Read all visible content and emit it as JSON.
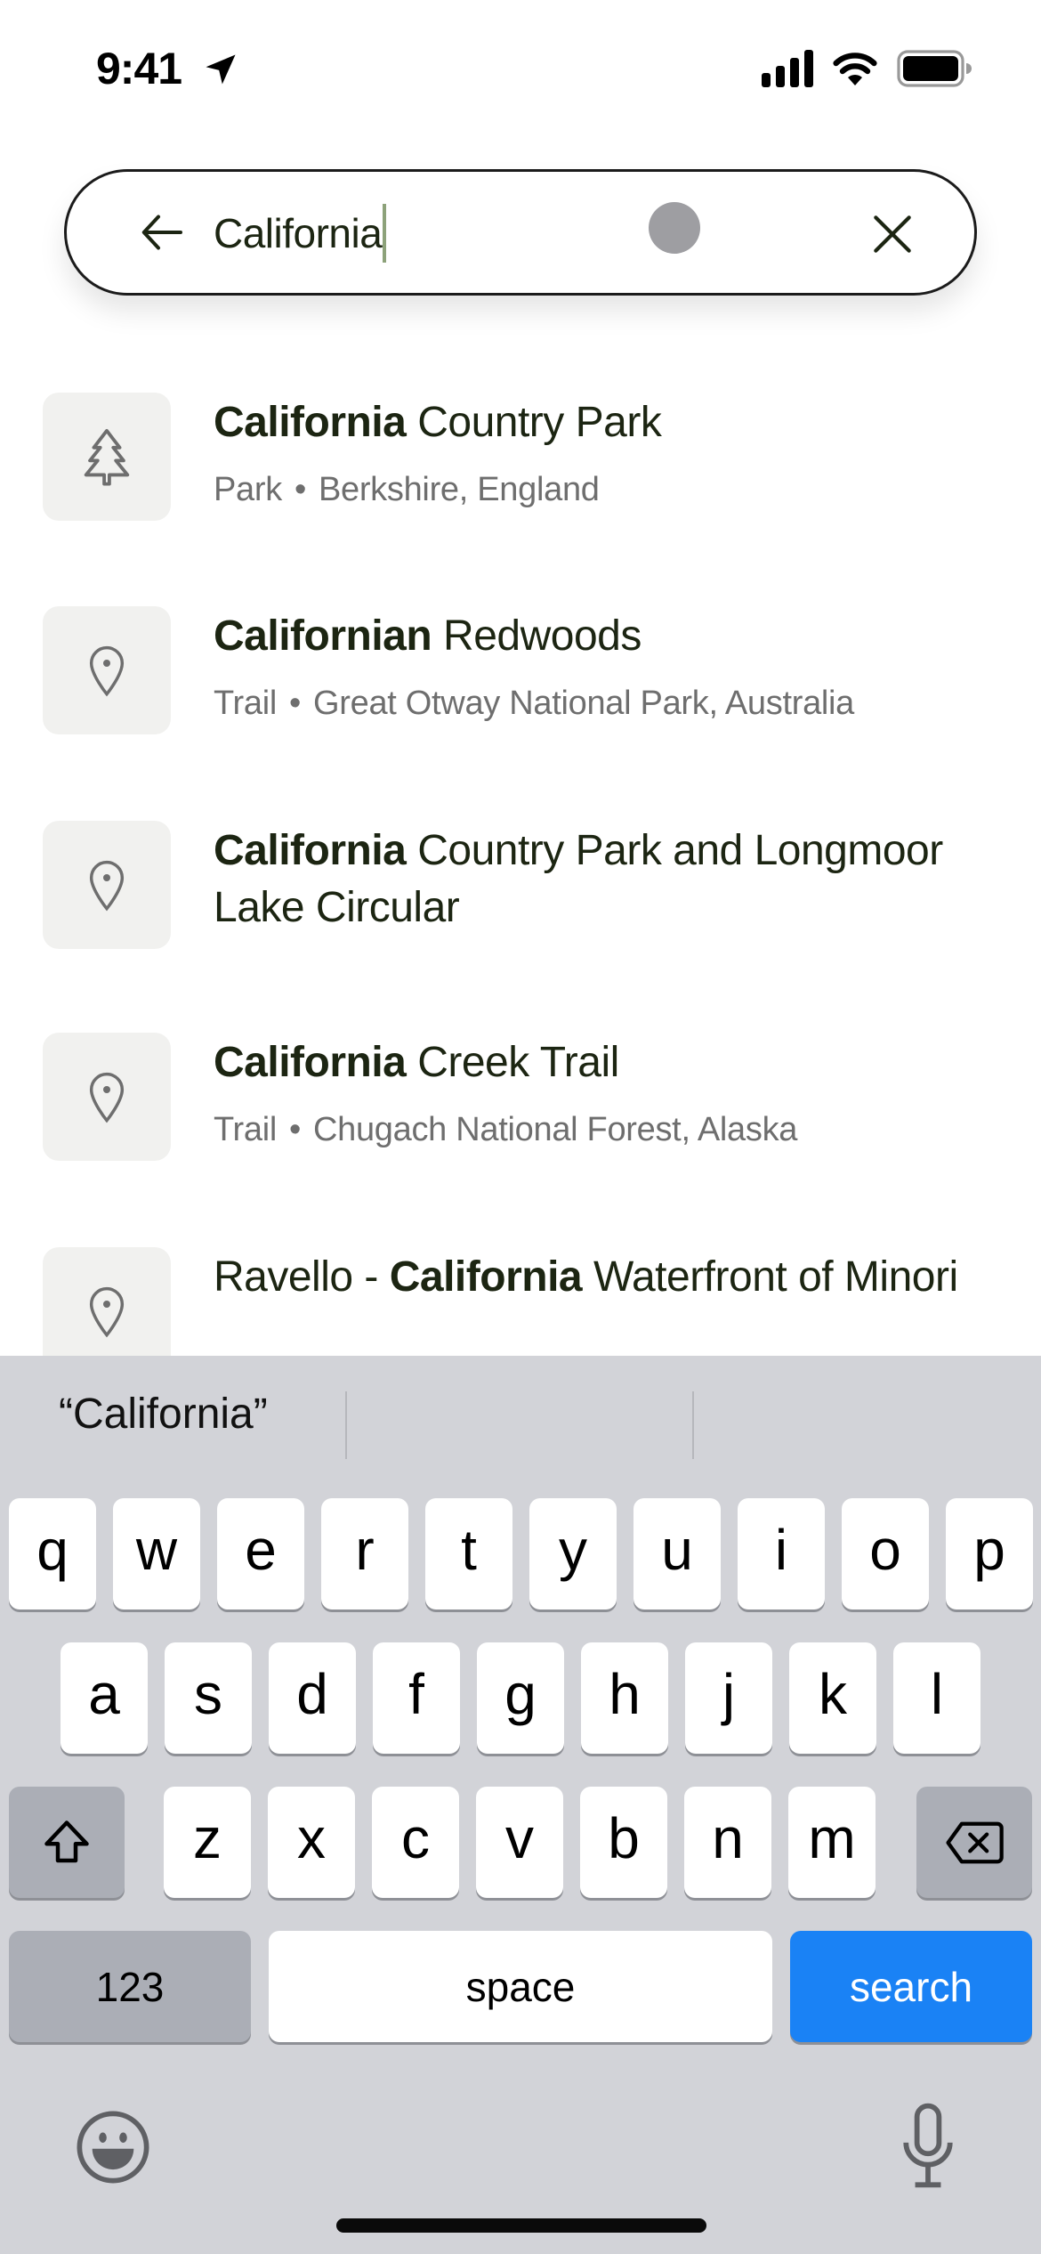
{
  "status_bar": {
    "time": "9:41",
    "icons": [
      "location-arrow-icon",
      "cellular-signal-icon",
      "wifi-icon",
      "battery-icon"
    ]
  },
  "search": {
    "query": "California",
    "back_icon": "arrow-left-icon",
    "clear_icon": "close-icon"
  },
  "results": [
    {
      "icon": "tree-icon",
      "title_pre": "",
      "title_bold": "California",
      "title_post": " Country Park",
      "type": "Park",
      "location": "Berkshire, England"
    },
    {
      "icon": "map-pin-icon",
      "title_pre": "",
      "title_bold": "Californi",
      "title_post": "an Redwoods",
      "type": "Trail",
      "location": "Great Otway National Park, Australia",
      "title_bold_full": "Californian"
    },
    {
      "icon": "map-pin-icon",
      "title_pre": "",
      "title_bold": "California",
      "title_post": " Country Park and Longmoor Lake Circular",
      "type": "",
      "location": ""
    },
    {
      "icon": "map-pin-icon",
      "title_pre": "",
      "title_bold": "California",
      "title_post": " Creek Trail",
      "type": "Trail",
      "location": "Chugach National Forest, Alaska"
    },
    {
      "icon": "map-pin-icon",
      "title_pre": "Ravello - ",
      "title_bold": "California",
      "title_post": " Waterfront of Minori",
      "type": "",
      "location": ""
    }
  ],
  "keyboard": {
    "suggestion": "“California”",
    "row1": [
      "q",
      "w",
      "e",
      "r",
      "t",
      "y",
      "u",
      "i",
      "o",
      "p"
    ],
    "row2": [
      "a",
      "s",
      "d",
      "f",
      "g",
      "h",
      "j",
      "k",
      "l"
    ],
    "row3": [
      "z",
      "x",
      "c",
      "v",
      "b",
      "n",
      "m"
    ],
    "shift_icon": "shift-icon",
    "delete_icon": "delete-backspace-icon",
    "numbers_label": "123",
    "space_label": "space",
    "action_label": "search",
    "emoji_icon": "emoji-icon",
    "mic_icon": "microphone-icon"
  },
  "colors": {
    "accent_text": "#1c2512",
    "search_key": "#1a82f5",
    "keyboard_bg": "#d2d3d8"
  }
}
